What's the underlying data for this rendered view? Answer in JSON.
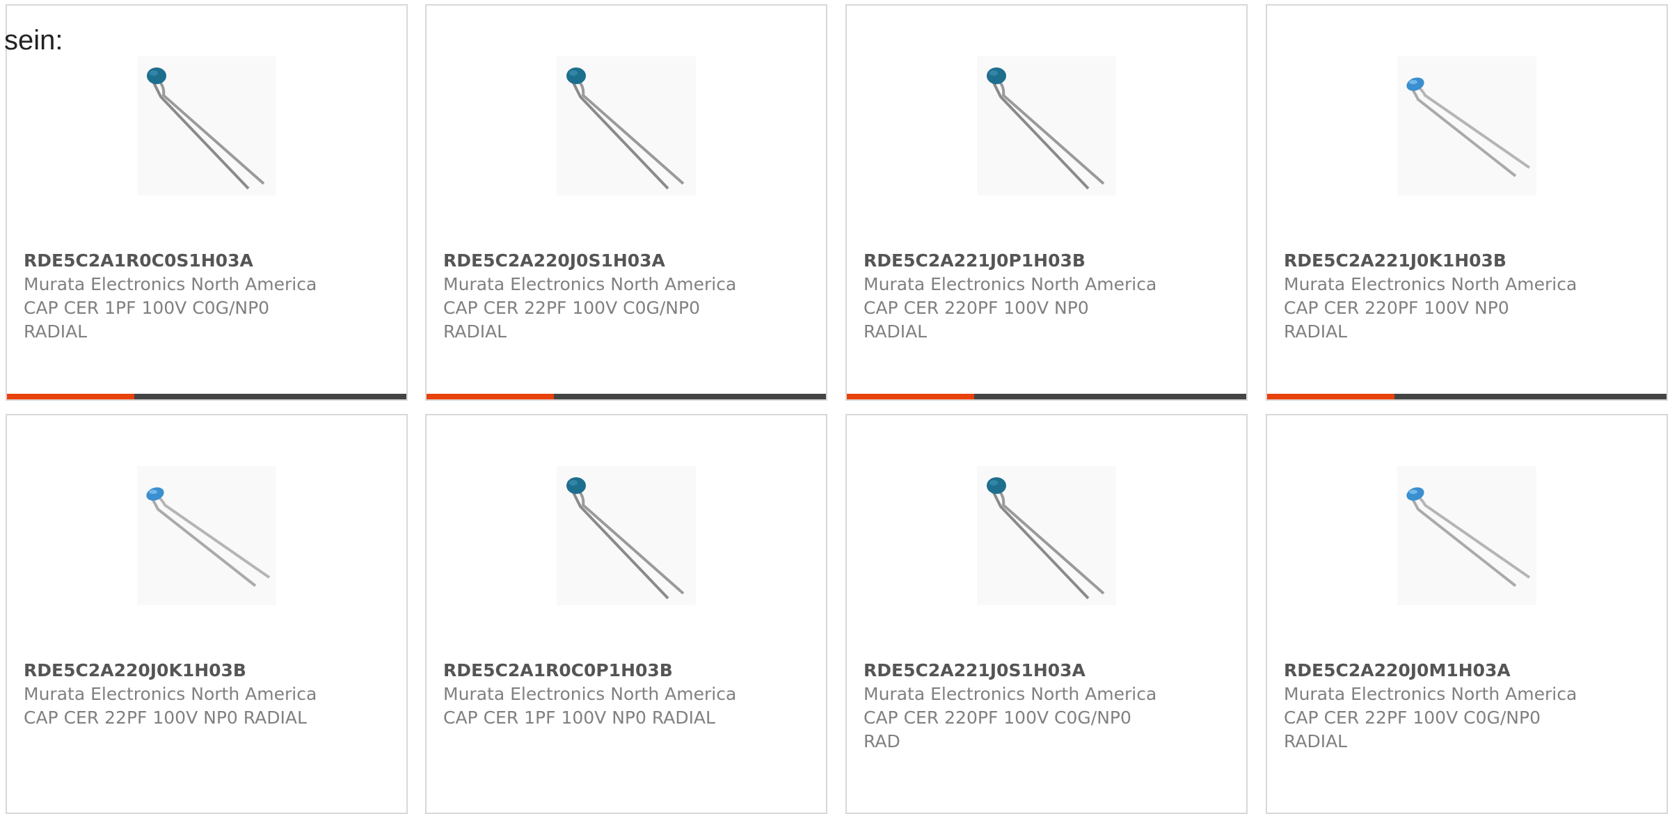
{
  "intro_text": "sein:",
  "colors": {
    "accent": "#e8420c",
    "bar_dark": "#444444",
    "card_border": "#d8d8d8",
    "capacitor_dark_blue": "#1e6e8e",
    "capacitor_light_blue": "#3a8fd0",
    "lead_wire": "#8a8a8a"
  },
  "products": [
    {
      "part_number": "RDE5C2A1R0C0S1H03A",
      "manufacturer": "Murata Electronics North America",
      "description_lines": [
        "CAP CER 1PF 100V C0G/NP0",
        "RADIAL"
      ],
      "image_icon": "capacitor-dark-icon",
      "has_accent_bar": true
    },
    {
      "part_number": "RDE5C2A220J0S1H03A",
      "manufacturer": "Murata Electronics North America",
      "description_lines": [
        "CAP CER 22PF 100V C0G/NP0",
        "RADIAL"
      ],
      "image_icon": "capacitor-dark-icon",
      "has_accent_bar": true
    },
    {
      "part_number": "RDE5C2A221J0P1H03B",
      "manufacturer": "Murata Electronics North America",
      "description_lines": [
        "CAP CER 220PF 100V NP0",
        "RADIAL"
      ],
      "image_icon": "capacitor-dark-icon",
      "has_accent_bar": true
    },
    {
      "part_number": "RDE5C2A221J0K1H03B",
      "manufacturer": "Murata Electronics North America",
      "description_lines": [
        "CAP CER 220PF 100V NP0",
        "RADIAL"
      ],
      "image_icon": "capacitor-light-icon",
      "has_accent_bar": true
    },
    {
      "part_number": "RDE5C2A220J0K1H03B",
      "manufacturer": "Murata Electronics North America",
      "description_lines": [
        "CAP CER 22PF 100V NP0 RADIAL"
      ],
      "image_icon": "capacitor-light-icon",
      "has_accent_bar": false
    },
    {
      "part_number": "RDE5C2A1R0C0P1H03B",
      "manufacturer": "Murata Electronics North America",
      "description_lines": [
        "CAP CER 1PF 100V NP0 RADIAL"
      ],
      "image_icon": "capacitor-dark-icon",
      "has_accent_bar": false
    },
    {
      "part_number": "RDE5C2A221J0S1H03A",
      "manufacturer": "Murata Electronics North America",
      "description_lines": [
        "CAP CER 220PF 100V C0G/NP0",
        "RAD"
      ],
      "image_icon": "capacitor-dark-icon",
      "has_accent_bar": false
    },
    {
      "part_number": "RDE5C2A220J0M1H03A",
      "manufacturer": "Murata Electronics North America",
      "description_lines": [
        "CAP CER 22PF 100V C0G/NP0",
        "RADIAL"
      ],
      "image_icon": "capacitor-light-icon",
      "has_accent_bar": false
    }
  ]
}
